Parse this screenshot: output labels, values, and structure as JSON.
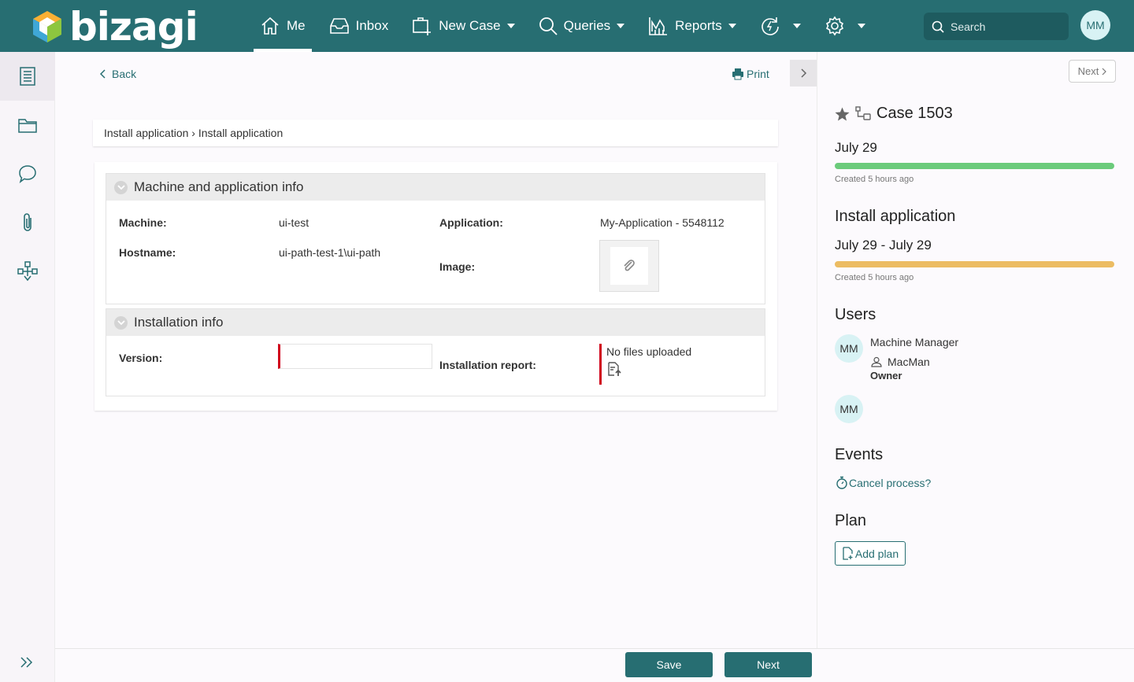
{
  "app": {
    "logo_text": "bizagi"
  },
  "nav": {
    "items": [
      {
        "label": "Me",
        "active": true
      },
      {
        "label": "Inbox"
      },
      {
        "label": "New Case"
      },
      {
        "label": "Queries"
      },
      {
        "label": "Reports"
      }
    ]
  },
  "search": {
    "placeholder": "Search"
  },
  "user": {
    "initials": "MM"
  },
  "toolbar": {
    "back_label": "Back",
    "print_label": "Print"
  },
  "breadcrumb": "Install application › Install application",
  "form": {
    "section1": {
      "title": "Machine and application info",
      "machine_label": "Machine:",
      "machine_value": "ui-test",
      "hostname_label": "Hostname:",
      "hostname_value": "ui-path-test-1\\ui-path",
      "application_label": "Application:",
      "application_value": "My-Application - 5548112",
      "image_label": "Image:"
    },
    "section2": {
      "title": "Installation info",
      "version_label": "Version:",
      "version_value": "",
      "report_label": "Installation report:",
      "no_files": "No files uploaded"
    }
  },
  "right_panel": {
    "next_label": "Next",
    "case_title": "Case 1503",
    "case_date": "July 29",
    "case_created": "Created 5 hours ago",
    "task_title": "Install application",
    "task_dates": "July 29 - July 29",
    "task_created": "Created 5 hours ago",
    "users_heading": "Users",
    "user1_initials": "MM",
    "user1_name": "Machine Manager",
    "user1_username": "MacMan",
    "user1_role": "Owner",
    "user2_initials": "MM",
    "events_heading": "Events",
    "cancel_label": "Cancel process?",
    "plan_heading": "Plan",
    "add_plan_label": "Add plan"
  },
  "colors": {
    "brand": "#276e72",
    "progress_case": "#6bcb7b",
    "progress_task": "#ecbc62",
    "required": "#d0021b"
  },
  "footer": {
    "save_label": "Save",
    "next_label": "Next"
  }
}
